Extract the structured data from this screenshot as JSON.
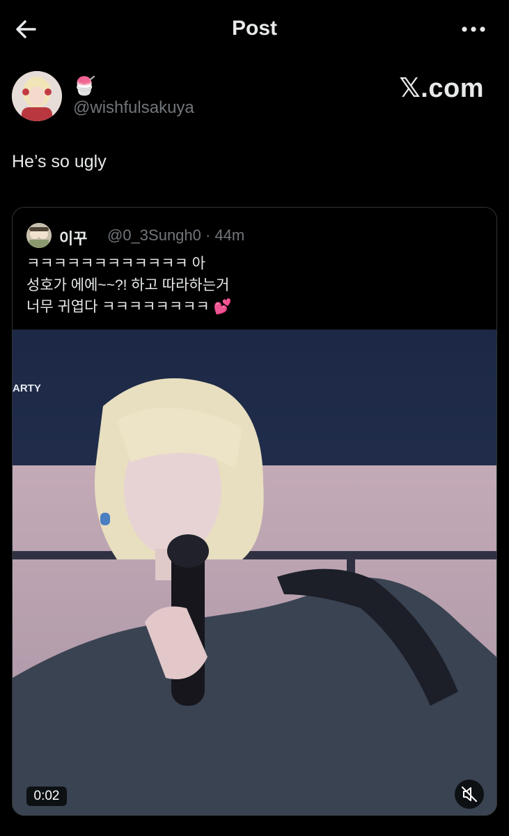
{
  "header": {
    "title": "Post",
    "back_icon": "arrow-left-icon",
    "more_icon": "more-horizontal-icon"
  },
  "author": {
    "display_name": "🍧",
    "handle": "@wishfulsakuya"
  },
  "watermark": "𝕏.com",
  "tweet": {
    "text": "He’s so ugly"
  },
  "quote": {
    "name": "이꾸",
    "handle": "@0_3Sungh0",
    "separator": " · ",
    "time": "44m",
    "lines": [
      "ㅋㅋㅋㅋㅋㅋㅋㅋㅋㅋㅋㅋ 아",
      "성호가 에에~~?! 하고 따라하는거",
      "너무 귀엽다 ㅋㅋㅋㅋㅋㅋㅋㅋ 💕"
    ],
    "media": {
      "overlay_text": "ARTY",
      "duration": "0:02",
      "mute_icon": "volume-muted-icon"
    }
  },
  "colors": {
    "background": "#000000",
    "text": "#e7e9ea",
    "muted": "#71767b",
    "border": "#2f3336"
  }
}
